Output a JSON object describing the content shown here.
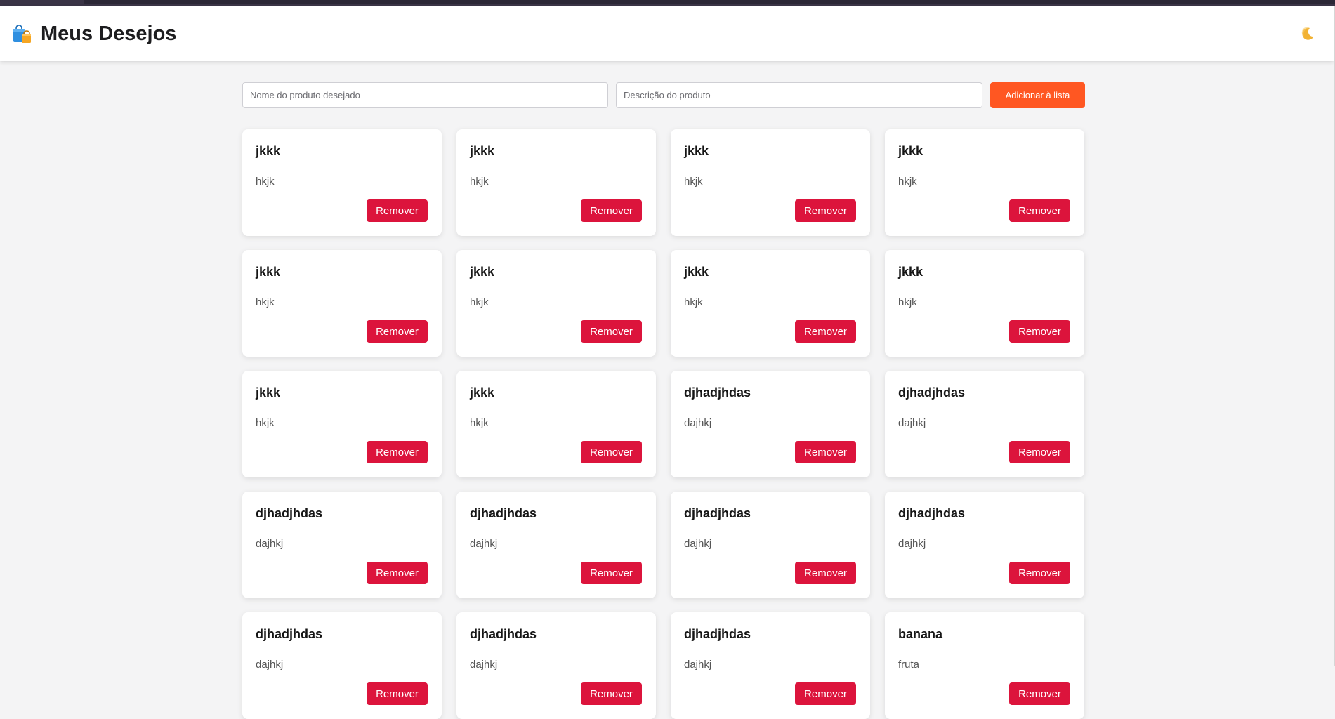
{
  "header": {
    "title": "Meus Desejos",
    "logo_icon": "shopping-bags-icon",
    "theme_toggle_icon": "moon-icon"
  },
  "form": {
    "name_placeholder": "Nome do produto desejado",
    "name_value": "",
    "description_placeholder": "Descrição do produto",
    "description_value": "",
    "add_label": "Adicionar à lista"
  },
  "colors": {
    "accent_orange": "#ff5722",
    "remove_red": "#dc143c",
    "background": "#f4f4f5"
  },
  "items": [
    {
      "title": "jkkk",
      "description": "hkjk",
      "remove_label": "Remover"
    },
    {
      "title": "jkkk",
      "description": "hkjk",
      "remove_label": "Remover"
    },
    {
      "title": "jkkk",
      "description": "hkjk",
      "remove_label": "Remover"
    },
    {
      "title": "jkkk",
      "description": "hkjk",
      "remove_label": "Remover"
    },
    {
      "title": "jkkk",
      "description": "hkjk",
      "remove_label": "Remover"
    },
    {
      "title": "jkkk",
      "description": "hkjk",
      "remove_label": "Remover"
    },
    {
      "title": "jkkk",
      "description": "hkjk",
      "remove_label": "Remover"
    },
    {
      "title": "jkkk",
      "description": "hkjk",
      "remove_label": "Remover"
    },
    {
      "title": "jkkk",
      "description": "hkjk",
      "remove_label": "Remover"
    },
    {
      "title": "jkkk",
      "description": "hkjk",
      "remove_label": "Remover"
    },
    {
      "title": "djhadjhdas",
      "description": "dajhkj",
      "remove_label": "Remover"
    },
    {
      "title": "djhadjhdas",
      "description": "dajhkj",
      "remove_label": "Remover"
    },
    {
      "title": "djhadjhdas",
      "description": "dajhkj",
      "remove_label": "Remover"
    },
    {
      "title": "djhadjhdas",
      "description": "dajhkj",
      "remove_label": "Remover"
    },
    {
      "title": "djhadjhdas",
      "description": "dajhkj",
      "remove_label": "Remover"
    },
    {
      "title": "djhadjhdas",
      "description": "dajhkj",
      "remove_label": "Remover"
    },
    {
      "title": "djhadjhdas",
      "description": "dajhkj",
      "remove_label": "Remover"
    },
    {
      "title": "djhadjhdas",
      "description": "dajhkj",
      "remove_label": "Remover"
    },
    {
      "title": "djhadjhdas",
      "description": "dajhkj",
      "remove_label": "Remover"
    },
    {
      "title": "banana",
      "description": "fruta",
      "remove_label": "Remover"
    }
  ]
}
